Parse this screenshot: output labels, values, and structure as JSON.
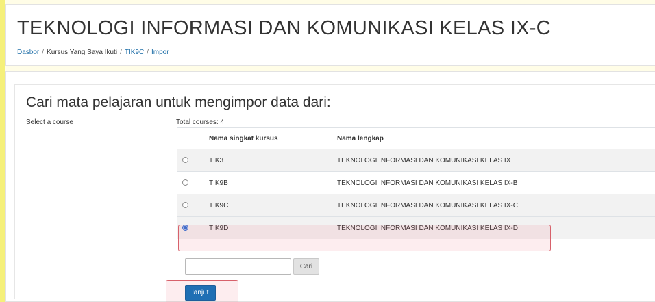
{
  "header": {
    "title": "TEKNOLOGI INFORMASI DAN KOMUNIKASI KELAS IX-C",
    "breadcrumb": [
      {
        "label": "Dasbor",
        "link": true
      },
      {
        "label": "Kursus Yang Saya Ikuti",
        "link": false
      },
      {
        "label": "TIK9C",
        "link": true
      },
      {
        "label": "Impor",
        "link": true
      }
    ],
    "separator": "/"
  },
  "main": {
    "heading": "Cari mata pelajaran untuk mengimpor data dari:",
    "select_label": "Select a course",
    "total_courses": "Total courses: 4",
    "table": {
      "headers": [
        "",
        "Nama singkat kursus",
        "Nama lengkap"
      ],
      "rows": [
        {
          "short": "TIK3",
          "full": "TEKNOLOGI INFORMASI DAN KOMUNIKASI KELAS IX",
          "selected": false
        },
        {
          "short": "TIK9B",
          "full": "TEKNOLOGI INFORMASI DAN KOMUNIKASI KELAS IX-B",
          "selected": false
        },
        {
          "short": "TIK9C",
          "full": "TEKNOLOGI INFORMASI DAN KOMUNIKASI KELAS IX-C",
          "selected": false
        },
        {
          "short": "TIK9D",
          "full": "TEKNOLOGI INFORMASI DAN KOMUNIKASI KELAS IX-D",
          "selected": true
        }
      ]
    },
    "search": {
      "value": "",
      "button_label": "Cari"
    },
    "next_button_label": "lanjut"
  },
  "colors": {
    "link": "#1f6fa8",
    "primary_button": "#1f6fb4",
    "highlight_border": "#d7616b",
    "side_strip": "#f5f07a"
  }
}
